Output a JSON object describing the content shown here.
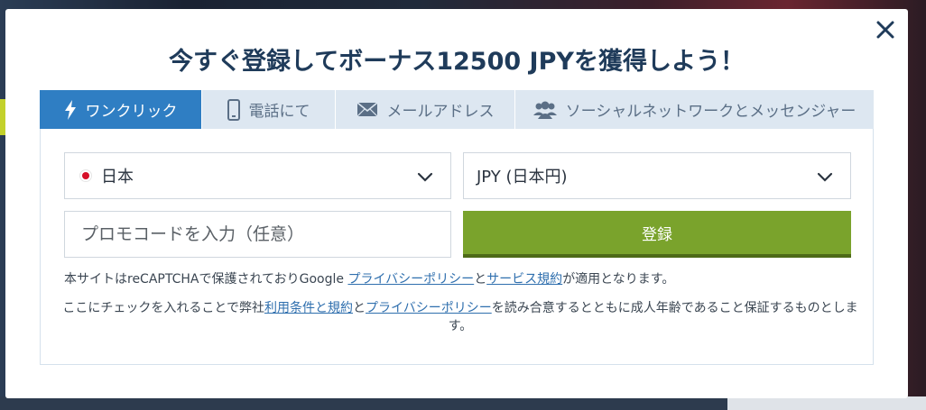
{
  "modal": {
    "title": "今すぐ登録してボーナス12500 JPYを獲得しよう！",
    "close_icon": "close-x-icon"
  },
  "tabs": [
    {
      "label": "ワンクリック",
      "icon": "lightning-icon",
      "active": true
    },
    {
      "label": "電話にて",
      "icon": "smartphone-icon",
      "active": false
    },
    {
      "label": "メールアドレス",
      "icon": "envelope-icon",
      "active": false
    },
    {
      "label": "ソーシャルネットワークとメッセンジャー",
      "icon": "users-icon",
      "active": false
    }
  ],
  "form": {
    "country": {
      "value": "日本",
      "flag": "japan-flag-icon"
    },
    "currency": {
      "value": "JPY (日本円)"
    },
    "promo_placeholder": "プロモコードを入力（任意）",
    "register_label": "登録"
  },
  "recaptcha_note": {
    "prefix": "本サイトはreCAPTCHAで保護されておりGoogle ",
    "privacy_link": "プライバシーポリシー",
    "middle": "と",
    "terms_link": "サービス規約",
    "suffix": "が適用となります。"
  },
  "consent": {
    "prefix": "ここにチェックを入れることで弊社",
    "terms_link": "利用条件と規約",
    "middle": "と",
    "privacy_link": "プライバシーポリシー",
    "suffix": "を読み合意するとともに成人年齢であること保証するものとします。"
  },
  "colors": {
    "title": "#1f3b5a",
    "tab_active": "#2f7ec3",
    "tab_inactive_bg": "#dde7f1",
    "register_bg": "#7aa32c",
    "link": "#2f6fae"
  }
}
